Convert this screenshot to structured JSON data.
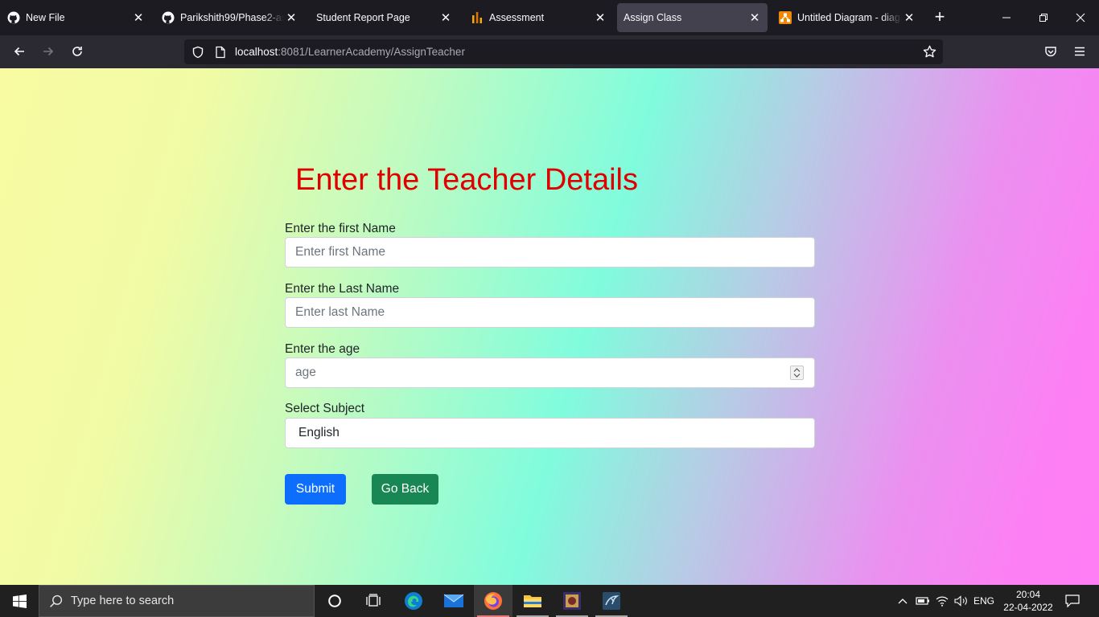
{
  "browser": {
    "tabs": [
      {
        "title": "New File",
        "icon": "github-icon"
      },
      {
        "title": "Parikshith99/Phase2-asse",
        "icon": "github-icon"
      },
      {
        "title": "Student Report Page",
        "icon": ""
      },
      {
        "title": "Assessment",
        "icon": "analytics-icon"
      },
      {
        "title": "Assign Class",
        "icon": "",
        "active": true
      },
      {
        "title": "Untitled Diagram - diagra",
        "icon": "drawio-icon"
      }
    ],
    "url": {
      "host": "localhost",
      "path": ":8081/LearnerAcademy/AssignTeacher"
    }
  },
  "form": {
    "heading": "Enter the Teacher Details",
    "first_name": {
      "label": "Enter the first Name",
      "placeholder": "Enter first Name",
      "value": ""
    },
    "last_name": {
      "label": "Enter the Last Name",
      "placeholder": "Enter last Name",
      "value": ""
    },
    "age": {
      "label": "Enter the age",
      "placeholder": "age",
      "value": ""
    },
    "subject": {
      "label": "Select Subject",
      "selected": "English"
    },
    "submit_label": "Submit",
    "back_label": "Go Back"
  },
  "taskbar": {
    "search_placeholder": "Type here to search",
    "language": "ENG",
    "time": "20:04",
    "date": "22-04-2022"
  },
  "colors": {
    "heading": "#e00000",
    "primary_button": "#0d6efd",
    "success_button": "#198754",
    "active_tab": "#42414d"
  }
}
